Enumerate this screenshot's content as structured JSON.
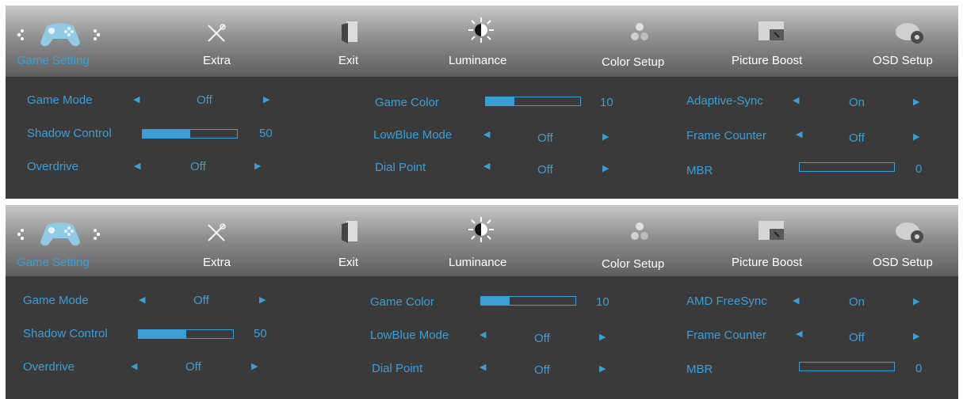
{
  "colors": {
    "accent": "#3b9fd6",
    "menu_text": "#ffffff",
    "background": "#3a3a3a"
  },
  "panels": [
    {
      "tabs": [
        {
          "icon": "gamepad-icon",
          "label": "Game Setting",
          "active": true
        },
        {
          "icon": "tools-icon",
          "label": "Extra"
        },
        {
          "icon": "exit-door-icon",
          "label": "Exit"
        },
        {
          "icon": "sun-icon",
          "label": "Luminance"
        },
        {
          "icon": "color-dots-icon",
          "label": "Color Setup"
        },
        {
          "icon": "picture-boost-icon",
          "label": "Picture Boost"
        },
        {
          "icon": "osd-gear-icon",
          "label": "OSD Setup"
        }
      ],
      "settings": {
        "game_mode": {
          "label": "Game Mode",
          "value": "Off"
        },
        "shadow_control": {
          "label": "Shadow Control",
          "value": "50",
          "level": 0.5
        },
        "overdrive": {
          "label": "Overdrive",
          "value": "Off"
        },
        "game_color": {
          "label": "Game Color",
          "value": "10",
          "level": 0.3
        },
        "lowblue_mode": {
          "label": "LowBlue Mode",
          "value": "Off"
        },
        "dial_point": {
          "label": "Dial Point",
          "value": "Off"
        },
        "sync": {
          "label": "Adaptive-Sync",
          "value": "On"
        },
        "frame_counter": {
          "label": "Frame Counter",
          "value": "Off"
        },
        "mbr": {
          "label": "MBR",
          "value": "0",
          "level": 0
        }
      }
    },
    {
      "tabs": [
        {
          "icon": "gamepad-icon",
          "label": "Game Setting",
          "active": true
        },
        {
          "icon": "tools-icon",
          "label": "Extra"
        },
        {
          "icon": "exit-door-icon",
          "label": "Exit"
        },
        {
          "icon": "sun-icon",
          "label": "Luminance"
        },
        {
          "icon": "color-dots-icon",
          "label": "Color Setup"
        },
        {
          "icon": "picture-boost-icon",
          "label": "Picture Boost"
        },
        {
          "icon": "osd-gear-icon",
          "label": "OSD Setup"
        }
      ],
      "settings": {
        "game_mode": {
          "label": "Game Mode",
          "value": "Off"
        },
        "shadow_control": {
          "label": "Shadow Control",
          "value": "50",
          "level": 0.5
        },
        "overdrive": {
          "label": "Overdrive",
          "value": "Off"
        },
        "game_color": {
          "label": "Game Color",
          "value": "10",
          "level": 0.3
        },
        "lowblue_mode": {
          "label": "LowBlue Mode",
          "value": "Off"
        },
        "dial_point": {
          "label": "Dial Point",
          "value": "Off"
        },
        "sync": {
          "label": "AMD FreeSync",
          "value": "On"
        },
        "frame_counter": {
          "label": "Frame Counter",
          "value": "Off"
        },
        "mbr": {
          "label": "MBR",
          "value": "0",
          "level": 0
        }
      }
    }
  ]
}
